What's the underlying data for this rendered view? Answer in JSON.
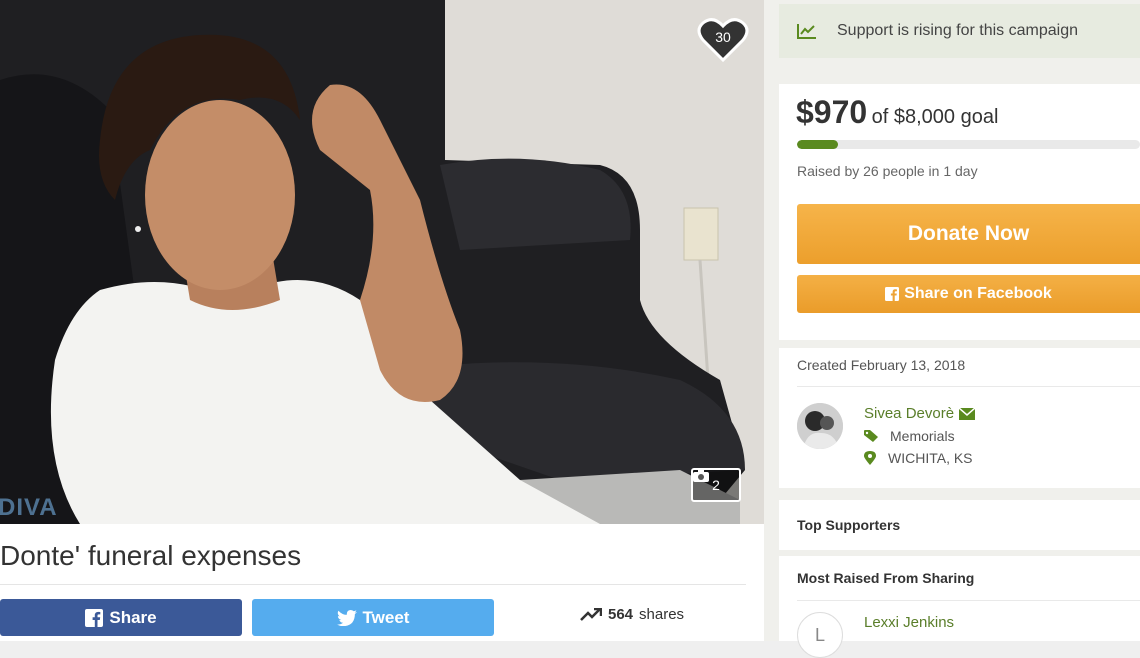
{
  "photo": {
    "like_count": "30",
    "photo_count": "2",
    "watermark": "DIVA"
  },
  "campaign": {
    "title": "Donte' funeral expenses",
    "share_label": "Share",
    "tweet_label": "Tweet",
    "shares_count": "564",
    "shares_label": "shares"
  },
  "sidebar": {
    "rising_text": "Support is rising for this campaign",
    "amount_raised": "$970",
    "goal_text": "of $8,000 goal",
    "progress_fraction": 0.12,
    "raised_by_text": "Raised by 26 people in 1 day",
    "donate_label": "Donate Now",
    "share_facebook_label": "Share on Facebook",
    "created_text": "Created February 13, 2018",
    "organizer_name": "Sivea Devorè",
    "category": "Memorials",
    "location": "WICHITA, KS",
    "top_supporters_title": "Top Supporters",
    "most_raised_title": "Most Raised From Sharing",
    "supporter_name": "Lexxi Jenkins",
    "supporter_initial": "L"
  },
  "colors": {
    "accent_green": "#5a8a1f",
    "donate_orange": "#f6b44a",
    "facebook_blue": "#3b5998",
    "twitter_blue": "#55acee"
  }
}
